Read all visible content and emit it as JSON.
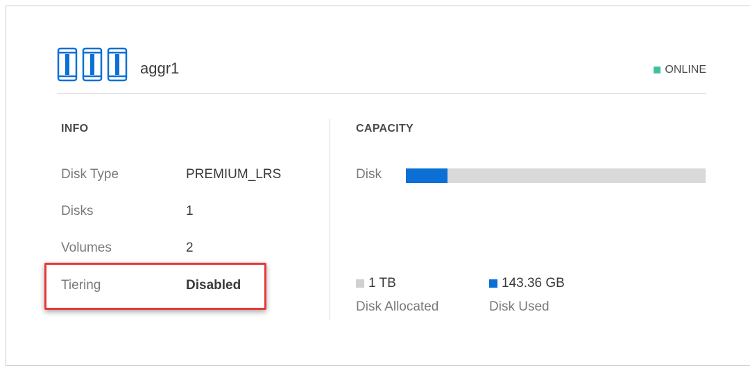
{
  "aggregate": {
    "name": "aggr1",
    "icon": "aggregate-disks-icon",
    "status_label": "ONLINE",
    "status_color": "#3ec1a0"
  },
  "info": {
    "title": "INFO",
    "rows": [
      {
        "label": "Disk Type",
        "value": "PREMIUM_LRS"
      },
      {
        "label": "Disks",
        "value": "1"
      },
      {
        "label": "Volumes",
        "value": "2"
      },
      {
        "label": "Tiering",
        "value": "Disabled"
      }
    ]
  },
  "capacity": {
    "title": "CAPACITY",
    "disk_label": "Disk",
    "used_fraction": 0.14,
    "allocated": {
      "value": "1 TB",
      "label": "Disk Allocated",
      "color": "#d0d0d0"
    },
    "used": {
      "value": "143.36 GB",
      "label": "Disk Used",
      "color": "#0b6fd6"
    }
  },
  "colors": {
    "accent_blue": "#0b6fd6",
    "highlight_red": "#e53935"
  }
}
